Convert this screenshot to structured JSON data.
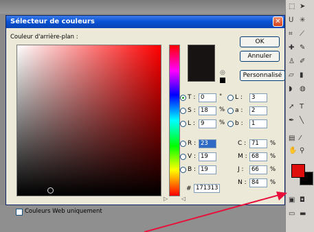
{
  "dialog": {
    "title": "Sélecteur de couleurs",
    "close_glyph": "✕",
    "background_label": "Couleur d'arrière-plan :",
    "ok_label": "OK",
    "cancel_label": "Annuler",
    "custom_label": "Personnalisé",
    "hex_symbol": "#",
    "hex_value": "171313",
    "web_only_label": "Couleurs Web uniquement",
    "web_only_checked": false,
    "current_color": "#171313"
  },
  "hsb": [
    {
      "label": "T :",
      "value": "0",
      "unit": "°",
      "selected": true
    },
    {
      "label": "S :",
      "value": "18",
      "unit": "%",
      "selected": false
    },
    {
      "label": "L :",
      "value": "9",
      "unit": "%",
      "selected": false
    }
  ],
  "lab": [
    {
      "label": "L :",
      "value": "3"
    },
    {
      "label": "a :",
      "value": "2"
    },
    {
      "label": "b :",
      "value": "1"
    }
  ],
  "rgb": [
    {
      "label": "R :",
      "value": "23"
    },
    {
      "label": "V :",
      "value": "19"
    },
    {
      "label": "B :",
      "value": "19"
    }
  ],
  "cmyk": [
    {
      "label": "C :",
      "value": "71",
      "unit": "%"
    },
    {
      "label": "M :",
      "value": "68",
      "unit": "%"
    },
    {
      "label": "J :",
      "value": "66",
      "unit": "%"
    },
    {
      "label": "N :",
      "value": "84",
      "unit": "%"
    }
  ],
  "toolbox": {
    "foreground_color": "#e00d0d",
    "background_color": "#000000",
    "icons": [
      "marquee-icon",
      "move-icon",
      "lasso-icon",
      "magic-wand-icon",
      "crop-icon",
      "slice-icon",
      "healing-icon",
      "brush-icon",
      "stamp-icon",
      "history-brush-icon",
      "eraser-icon",
      "gradient-icon",
      "blur-icon",
      "dodge-icon",
      "path-select-icon",
      "type-icon",
      "pen-icon",
      "shape-icon",
      "notes-icon",
      "eyedropper-icon",
      "hand-icon",
      "zoom-icon"
    ]
  },
  "colors": {
    "titlebar": "#0a53d6",
    "dialog_bg": "#ece9d8",
    "arrow": "#e8103a"
  }
}
